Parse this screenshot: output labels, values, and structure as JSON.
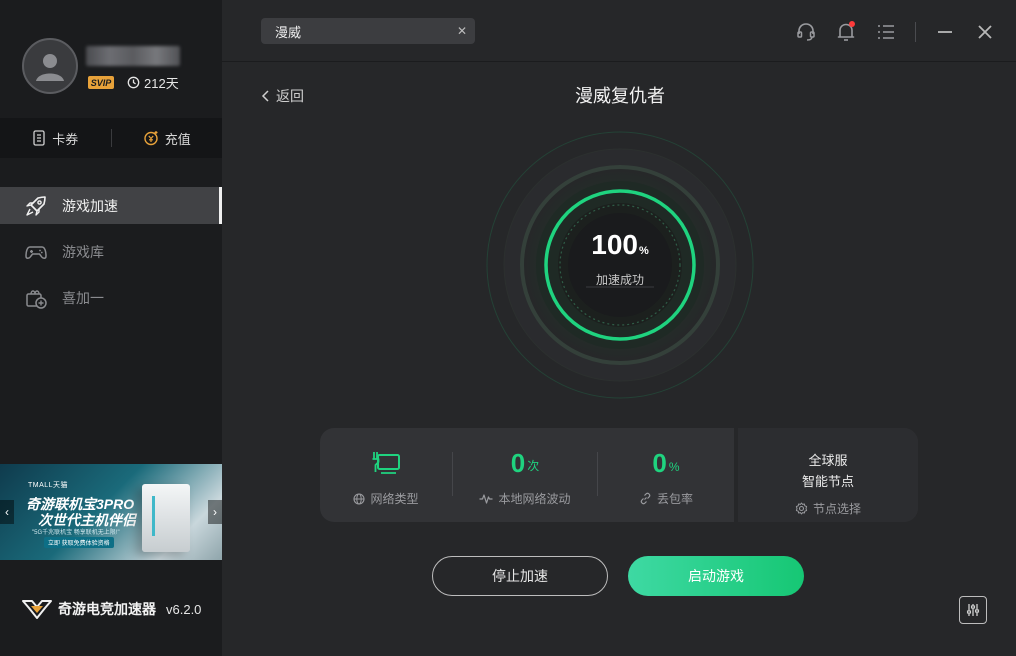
{
  "user": {
    "badge": "SVIP",
    "days": "212天"
  },
  "wallet": {
    "coupon_label": "卡券",
    "recharge_label": "充值"
  },
  "nav": [
    {
      "label": "游戏加速",
      "icon": "rocket-icon",
      "active": true
    },
    {
      "label": "游戏库",
      "icon": "gamepad-icon",
      "active": false
    },
    {
      "label": "喜加一",
      "icon": "gift-plus-icon",
      "active": false
    }
  ],
  "banner": {
    "tmall": "TMALL天猫",
    "line1": "奇游联机宝3PRO",
    "line2": "次世代主机伴侣",
    "sub": "\"5G千兆联机宝 畅享联机无上限!\"",
    "cta": "立即 获取免费体验资格"
  },
  "brand": {
    "name": "奇游电竞加速器",
    "version": "v6.2.0"
  },
  "search": {
    "value": "漫威"
  },
  "back_label": "返回",
  "game_title": "漫威复仇者",
  "progress": {
    "value": "100",
    "unit": "%",
    "label": "加速成功",
    "fraction": 1.0
  },
  "stats": {
    "network_type_label": "网络类型",
    "fluctuation_value": "0",
    "fluctuation_unit": "次",
    "fluctuation_label": "本地网络波动",
    "loss_value": "0",
    "loss_unit": "%",
    "loss_label": "丢包率",
    "node_line1": "全球服",
    "node_line2": "智能节点",
    "node_select_label": "节点选择"
  },
  "actions": {
    "stop_label": "停止加速",
    "start_label": "启动游戏"
  },
  "colors": {
    "accent": "#1fd37f",
    "sidebar": "#1b1c1e",
    "main": "#262729",
    "svip": "#e8a23a"
  }
}
